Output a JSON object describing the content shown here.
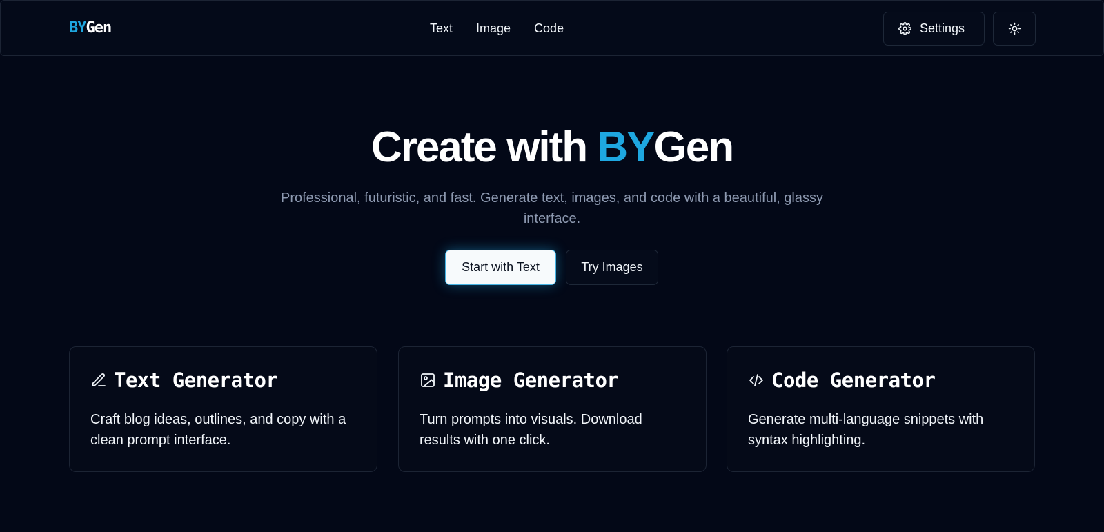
{
  "brand": {
    "accent": "BY",
    "rest": "Gen"
  },
  "nav": {
    "links": [
      "Text",
      "Image",
      "Code"
    ]
  },
  "header": {
    "settings_label": "Settings",
    "settings_icon": "gear-icon",
    "theme_icon": "sun-icon"
  },
  "hero": {
    "title_prefix": "Create with ",
    "title_accent": "BY",
    "title_rest": "Gen",
    "subtitle": "Professional, futuristic, and fast. Generate text, images, and code with a beautiful, glassy interface.",
    "primary_cta": "Start with Text",
    "secondary_cta": "Try Images"
  },
  "cards": [
    {
      "icon": "pen-icon",
      "title": "Text Generator",
      "description": "Craft blog ideas, outlines, and copy with a clean prompt interface."
    },
    {
      "icon": "image-icon",
      "title": "Image Generator",
      "description": "Turn prompts into visuals. Download results with one click."
    },
    {
      "icon": "code-icon",
      "title": "Code Generator",
      "description": "Generate multi-language snippets with syntax highlighting."
    }
  ],
  "colors": {
    "accent": "#1ea7e0",
    "background": "#030817",
    "border": "#1c2434"
  }
}
